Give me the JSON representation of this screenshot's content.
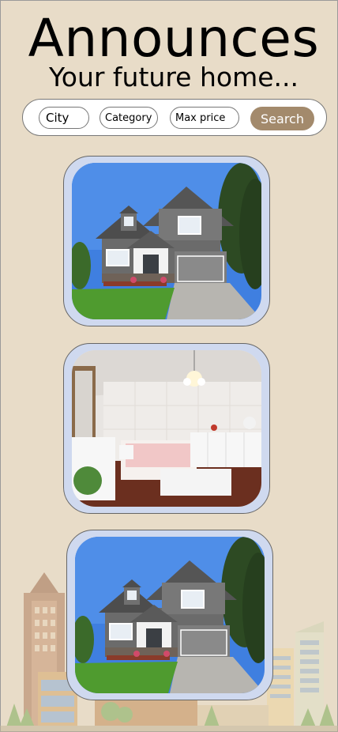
{
  "header": {
    "title": "Announces",
    "subtitle": "Your future home..."
  },
  "search": {
    "city_placeholder": "City",
    "category_placeholder": "Category",
    "max_price_placeholder": "Max price",
    "button_label": "Search"
  },
  "listings": [
    {
      "photo": "house-exterior-image"
    },
    {
      "photo": "bedroom-interior-image"
    },
    {
      "photo": "house-exterior-image"
    }
  ],
  "colors": {
    "background": "#e8dcc8",
    "card": "#cfd9ef",
    "search_button": "#a38a6c"
  }
}
